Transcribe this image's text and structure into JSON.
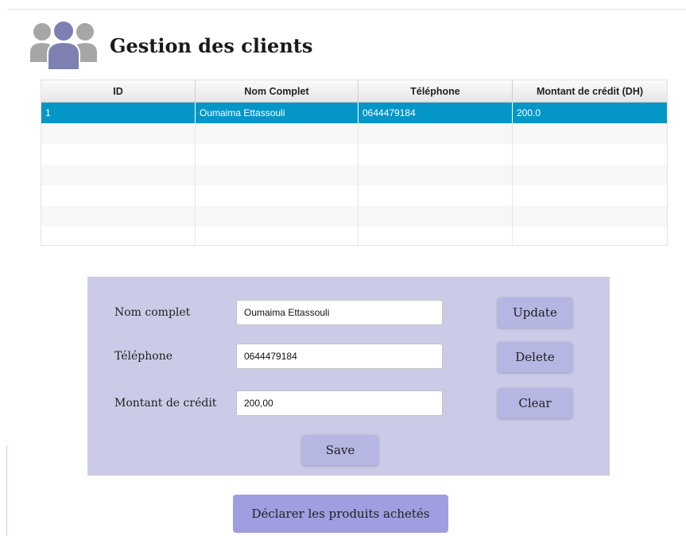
{
  "header": {
    "title": "Gestion des clients",
    "icon": "users-group-icon",
    "icon_colors": {
      "front": "#7e80b2",
      "back": "#a6a6a6"
    }
  },
  "table": {
    "columns": [
      "ID",
      "Nom Complet",
      "Téléphone",
      "Montant de crédit (DH)"
    ],
    "rows": [
      [
        "1",
        "Oumaima Ettassouli",
        "0644479184",
        "200.0"
      ]
    ],
    "selected_row": 0,
    "selection_color": "#0496c7"
  },
  "form": {
    "panel_color": "#cbcbe7",
    "fields": {
      "nom": {
        "label": "Nom complet",
        "value": "Oumaima Ettassouli"
      },
      "telephone": {
        "label": "Téléphone",
        "value": "0644479184"
      },
      "credit": {
        "label": "Montant de crédit",
        "value": "200,00"
      }
    },
    "buttons": {
      "update": "Update",
      "delete": "Delete",
      "clear": "Clear",
      "save": "Save"
    }
  },
  "footer": {
    "declare_button": "Déclarer les produits achetés"
  }
}
